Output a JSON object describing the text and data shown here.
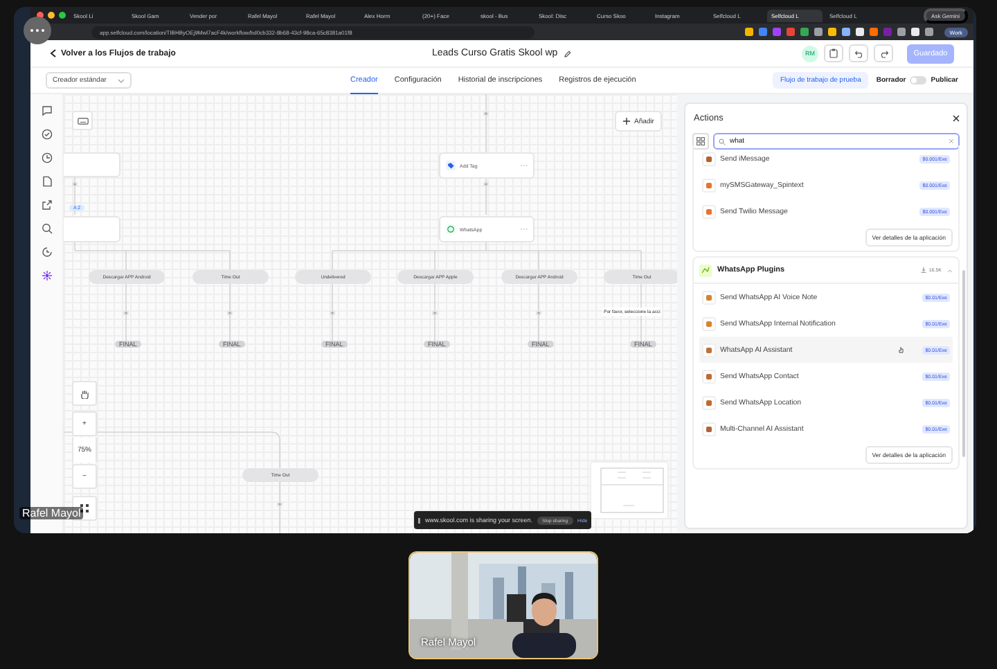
{
  "browser": {
    "tabs": [
      {
        "label": "Skool Li",
        "selected": false
      },
      {
        "label": "Skool Gam",
        "selected": false
      },
      {
        "label": "Vender por",
        "selected": false
      },
      {
        "label": "Rafel Mayol",
        "selected": false
      },
      {
        "label": "Rafel Mayol",
        "selected": false
      },
      {
        "label": "Alex Horm",
        "selected": false
      },
      {
        "label": "(20+) Face",
        "selected": false
      },
      {
        "label": "skool - Bus",
        "selected": false
      },
      {
        "label": "Skool: Disc",
        "selected": false
      },
      {
        "label": "Curso Skoo",
        "selected": false
      },
      {
        "label": "Instagram",
        "selected": false
      },
      {
        "label": "Selfcloud L",
        "selected": false
      },
      {
        "label": "Selfcloud L",
        "selected": true
      },
      {
        "label": "Selfcloud L",
        "selected": false
      }
    ],
    "address": "app.selfcloud.com/location/TIBHByOEj9Mwl7acF4k/workflow/bd0cb332-8b68-43cf-98ca-65c8381a01f8",
    "gemini": "Ask Gemini",
    "profile": "Work"
  },
  "header": {
    "back": "Volver a los Flujos de trabajo",
    "title": "Leads Curso Gratis Skool wp",
    "avatar": "RM",
    "save": "Guardado"
  },
  "toolbar": {
    "builder": "Creador estándar",
    "tabs": [
      {
        "label": "Creador",
        "selected": true
      },
      {
        "label": "Configuración",
        "selected": false
      },
      {
        "label": "Historial de inscripciones",
        "selected": false
      },
      {
        "label": "Registros de ejecución",
        "selected": false
      }
    ],
    "test": "Flujo de trabajo de prueba",
    "draft": "Borrador",
    "publish_on": false,
    "publish": "Publicar"
  },
  "canvas": {
    "add": "Añadir",
    "chip": "A 2",
    "nodes": [
      {
        "label": "Add Tag",
        "kind": "tag"
      },
      {
        "label": "WhatsApp",
        "kind": "whatsapp"
      }
    ],
    "branches": [
      "Descargar APP Android",
      "Time Out",
      "Undelivered",
      "Descargar APP Apple",
      "Descargar APP Android",
      "Time Out"
    ],
    "finals": [
      "FINAL",
      "FINAL",
      "FINAL",
      "FINAL",
      "FINAL",
      "FINAL"
    ],
    "tooltip": "Por favor, seleccione la acci",
    "lower_branch": "Time Out",
    "zoom_in": "+",
    "zoom": "75%",
    "zoom_out": "−"
  },
  "share_bar": {
    "message": "www.skool.com is sharing your screen.",
    "stop": "Stop sharing",
    "hide": "Hide"
  },
  "panel": {
    "title": "Actions",
    "search": "what",
    "groups": [
      {
        "items": [
          {
            "name": "Send iMessage",
            "price": "$0.001/Exe",
            "color": "#b4622a",
            "hovered": false
          },
          {
            "name": "mySMSGateway_Spintext",
            "price": "$0.001/Exe",
            "color": "#e8742c",
            "hovered": false
          },
          {
            "name": "Send Twilio Message",
            "price": "$0.001/Exe",
            "color": "#e8742c",
            "hovered": false
          }
        ],
        "details": "Ver detalles de la aplicación"
      },
      {
        "title": "WhatsApp Plugins",
        "downloads": "16.5K",
        "items": [
          {
            "name": "Send WhatsApp AI Voice Note",
            "price": "$0.01/Exe",
            "color": "#d9822b",
            "hovered": false
          },
          {
            "name": "Send WhatsApp Internal Notification",
            "price": "$0.01/Exe",
            "color": "#d9822b",
            "hovered": false
          },
          {
            "name": "WhatsApp AI Assistant",
            "price": "$0.01/Exe",
            "color": "#c0703a",
            "hovered": true
          },
          {
            "name": "Send WhatsApp Contact",
            "price": "$0.01/Exe",
            "color": "#c2692e",
            "hovered": false
          },
          {
            "name": "Send WhatsApp Location",
            "price": "$0.01/Exe",
            "color": "#c2692e",
            "hovered": false
          },
          {
            "name": "Multi-Channel AI Assistant",
            "price": "$0.01/Exe",
            "color": "#b0643a",
            "hovered": false
          }
        ],
        "details": "Ver detalles de la aplicación"
      }
    ]
  },
  "call": {
    "presenter": "Rafel Mayol",
    "tile_name": "Rafel Mayol"
  }
}
